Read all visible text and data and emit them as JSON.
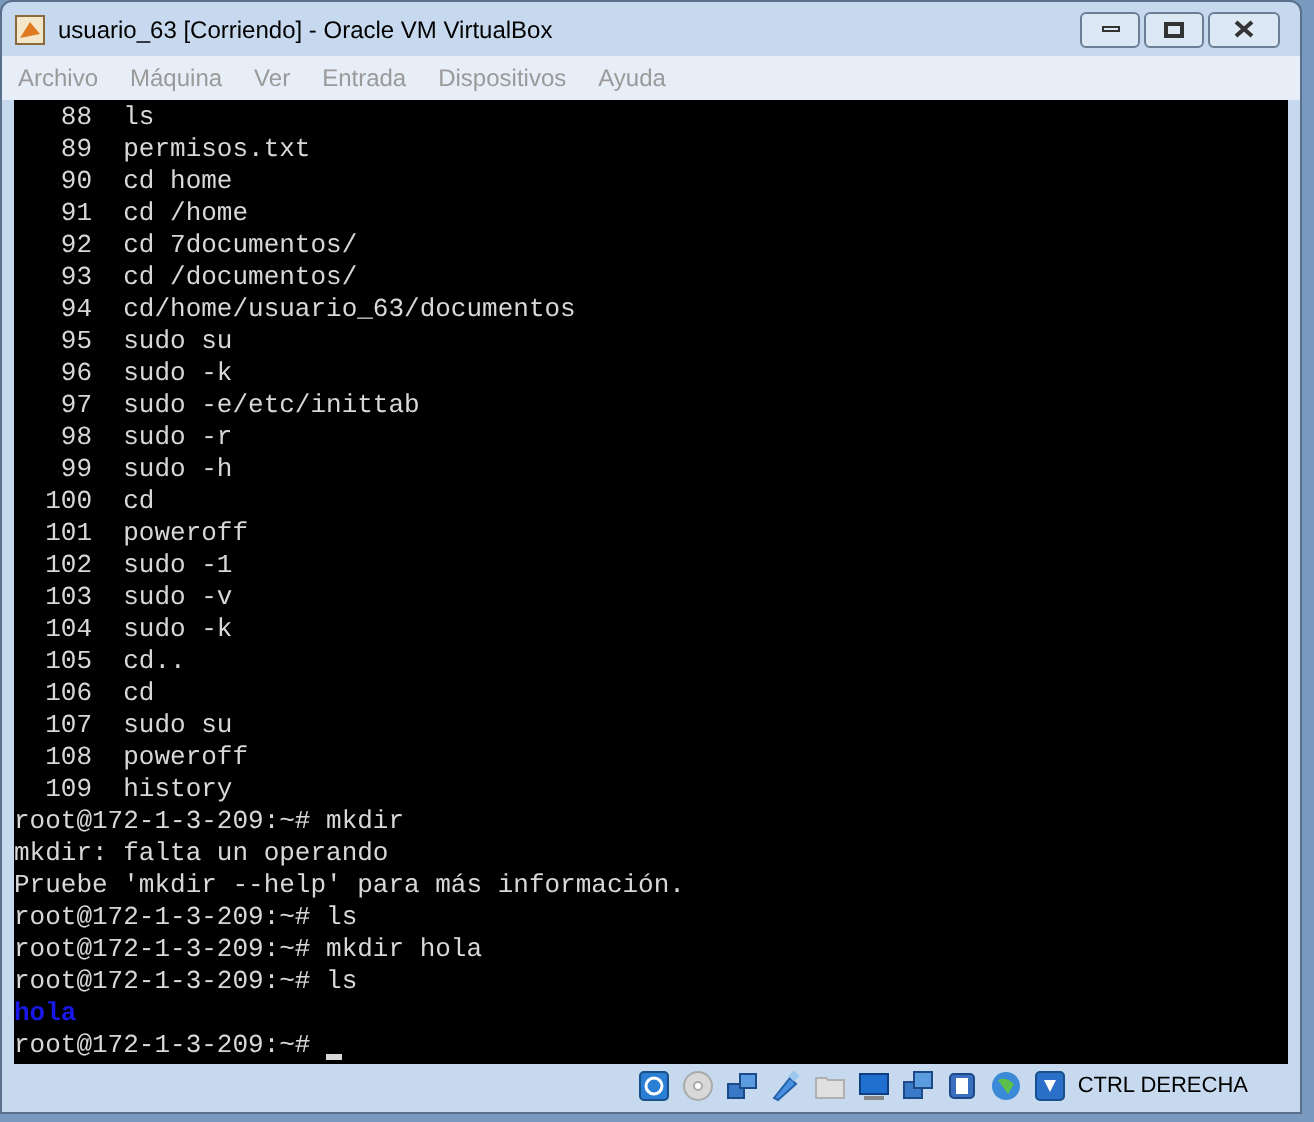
{
  "window": {
    "title": "usuario_63 [Corriendo] - Oracle VM VirtualBox"
  },
  "menu": [
    {
      "label": "Archivo",
      "disabled": true
    },
    {
      "label": "Máquina",
      "disabled": true
    },
    {
      "label": "Ver",
      "disabled": true
    },
    {
      "label": "Entrada",
      "disabled": true
    },
    {
      "label": "Dispositivos",
      "disabled": true
    },
    {
      "label": "Ayuda",
      "disabled": true
    }
  ],
  "terminal": {
    "lines": [
      {
        "kind": "output",
        "text": "   88  ls"
      },
      {
        "kind": "output",
        "text": "   89  permisos.txt"
      },
      {
        "kind": "output",
        "text": "   90  cd home"
      },
      {
        "kind": "output",
        "text": "   91  cd /home"
      },
      {
        "kind": "output",
        "text": "   92  cd 7documentos/"
      },
      {
        "kind": "output",
        "text": "   93  cd /documentos/"
      },
      {
        "kind": "output",
        "text": "   94  cd/home/usuario_63/documentos"
      },
      {
        "kind": "output",
        "text": "   95  sudo su"
      },
      {
        "kind": "output",
        "text": "   96  sudo -k"
      },
      {
        "kind": "output",
        "text": "   97  sudo -e/etc/inittab"
      },
      {
        "kind": "output",
        "text": "   98  sudo -r"
      },
      {
        "kind": "output",
        "text": "   99  sudo -h"
      },
      {
        "kind": "output",
        "text": "  100  cd"
      },
      {
        "kind": "output",
        "text": "  101  poweroff"
      },
      {
        "kind": "output",
        "text": "  102  sudo -1"
      },
      {
        "kind": "output",
        "text": "  103  sudo -v"
      },
      {
        "kind": "output",
        "text": "  104  sudo -k"
      },
      {
        "kind": "output",
        "text": "  105  cd.."
      },
      {
        "kind": "output",
        "text": "  106  cd"
      },
      {
        "kind": "output",
        "text": "  107  sudo su"
      },
      {
        "kind": "output",
        "text": "  108  poweroff"
      },
      {
        "kind": "output",
        "text": "  109  history"
      },
      {
        "kind": "output",
        "text": "root@172-1-3-209:~# mkdir"
      },
      {
        "kind": "output",
        "text": "mkdir: falta un operando"
      },
      {
        "kind": "output",
        "text": "Pruebe 'mkdir --help' para más información."
      },
      {
        "kind": "output",
        "text": "root@172-1-3-209:~# ls"
      },
      {
        "kind": "output",
        "text": "root@172-1-3-209:~# mkdir hola"
      },
      {
        "kind": "output",
        "text": "root@172-1-3-209:~# ls"
      },
      {
        "kind": "directory",
        "text": "hola"
      },
      {
        "kind": "prompt",
        "text": "root@172-1-3-209:~# "
      }
    ]
  },
  "status_bar": {
    "host_key": "CTRL DERECHA"
  }
}
